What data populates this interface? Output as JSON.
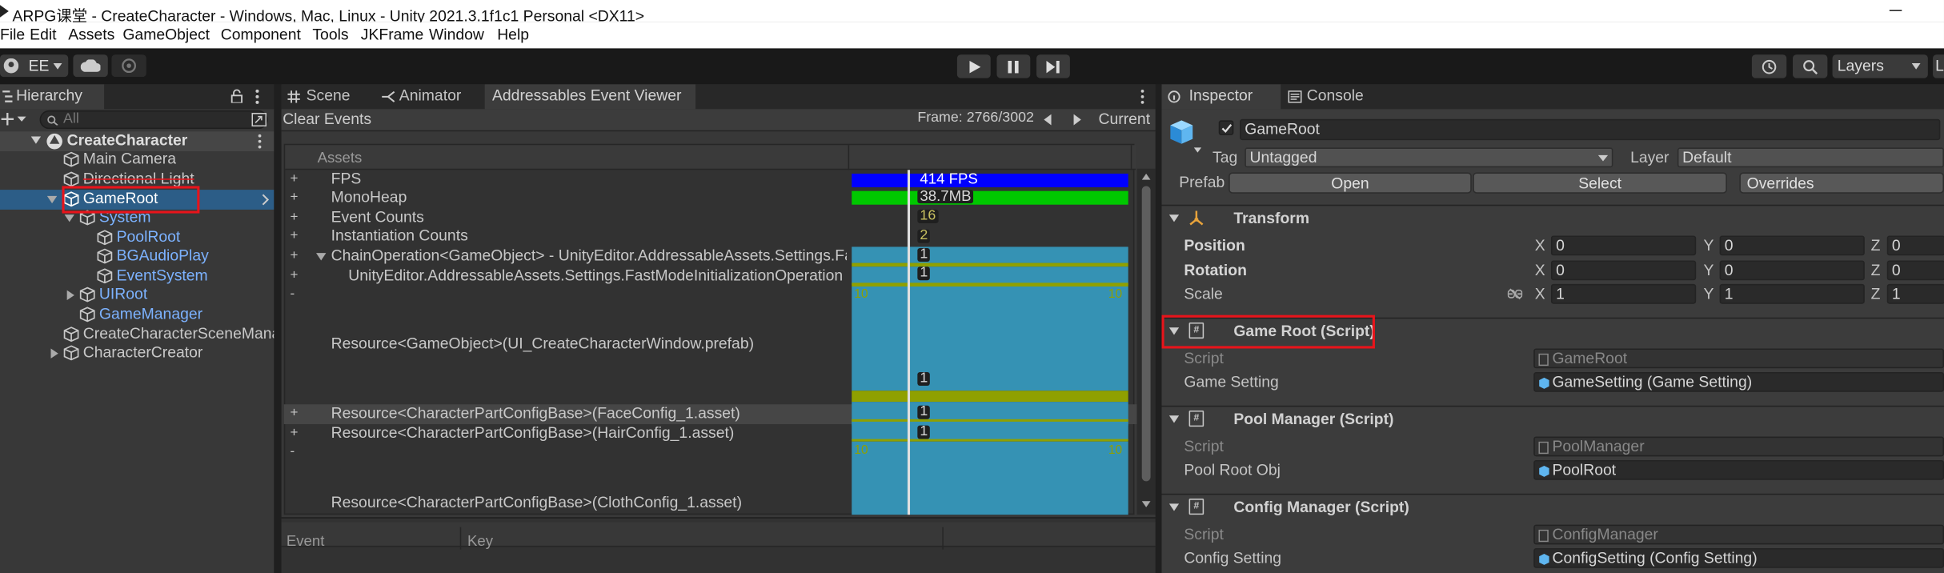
{
  "window": {
    "title": "ARPG课堂 - CreateCharacter - Windows, Mac, Linux - Unity 2021.3.1f1c1 Personal <DX11>"
  },
  "menu": [
    "File",
    "Edit",
    "Assets",
    "GameObject",
    "Component",
    "Tools",
    "JKFrame",
    "Window",
    "Help"
  ],
  "toolbar": {
    "account": "EE",
    "layers": "Layers",
    "layout": "L"
  },
  "hierarchy": {
    "tab": "Hierarchy",
    "search_placeholder": "All",
    "scene": "CreateCharacter",
    "items": [
      "Main Camera",
      "Directional Light",
      "GameRoot",
      "System",
      "PoolRoot",
      "BGAudioPlay",
      "EventSystem",
      "UIRoot",
      "GameManager",
      "CreateCharacterSceneManager",
      "CharacterCreator"
    ]
  },
  "center": {
    "tabs": [
      "Scene",
      "Animator",
      "Addressables Event Viewer"
    ],
    "clear_events": "Clear Events",
    "frame": "Frame: 2766/3002",
    "current": "Current",
    "assets_header": "Assets",
    "rows": [
      "FPS",
      "MonoHeap",
      "Event Counts",
      "Instantiation Counts",
      "ChainOperation<GameObject> - UnityEditor.AddressableAssets.Settings.FastModeInitializationOperation",
      "UnityEditor.AddressableAssets.Settings.FastModeInitializationOperation",
      "Resource<GameObject>(UI_CreateCharacterWindow.prefab)",
      "Resource<CharacterPartConfigBase>(FaceConfig_1.asset)",
      "Resource<CharacterPartConfigBase>(HairConfig_1.asset)",
      "Resource<CharacterPartConfigBase>(ClothConfig_1.asset)"
    ],
    "fps": "414 FPS",
    "heap": "38.7MB",
    "event_count": "16",
    "inst_count": "2",
    "one": "1",
    "ten": "10",
    "cols": [
      "Event",
      "Key"
    ]
  },
  "inspector": {
    "tabs": [
      "Inspector",
      "Console"
    ],
    "object": "GameRoot",
    "tag_label": "Tag",
    "tag": "Untagged",
    "layer_label": "Layer",
    "layer": "Default",
    "prefab_label": "Prefab",
    "open": "Open",
    "select": "Select",
    "overrides": "Overrides",
    "transform": "Transform",
    "position": "Position",
    "rotation": "Rotation",
    "scale": "Scale",
    "x": "X",
    "y": "Y",
    "z": "Z",
    "pos": [
      "0",
      "0",
      "0"
    ],
    "rot": [
      "0",
      "0",
      "0"
    ],
    "scl": [
      "1",
      "1",
      "1"
    ],
    "c1": "Game Root (Script)",
    "script": "Script",
    "c1_script": "GameRoot",
    "c1_field": "Game Setting",
    "c1_value": "GameSetting (Game Setting)",
    "c2": "Pool Manager (Script)",
    "c2_script": "PoolManager",
    "c2_field": "Pool Root Obj",
    "c2_value": "PoolRoot",
    "c3": "Config Manager (Script)",
    "c3_script": "ConfigManager",
    "c3_field": "Config Setting",
    "c3_value": "ConfigSetting (Config Setting)"
  },
  "colors": {
    "accent_blue": "#0000ff",
    "green": "#00c800",
    "teal": "#3592b4",
    "olive": "#8fa000",
    "selection": "#2c5d87",
    "highlight": "#e8141b"
  }
}
